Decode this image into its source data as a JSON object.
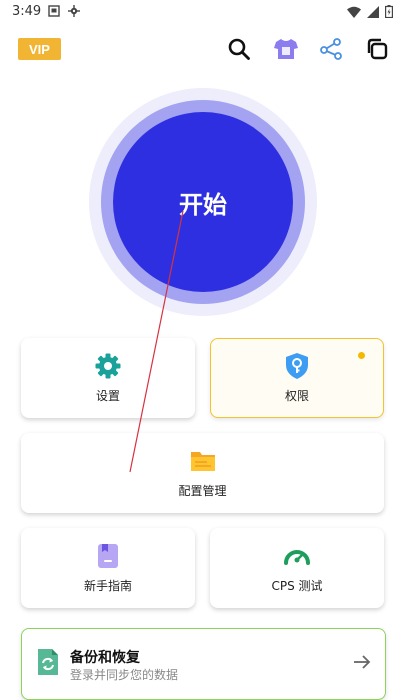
{
  "status_bar": {
    "time": "3:49",
    "left_icons": [
      "sim-card-icon",
      "settings-gear-icon"
    ],
    "right_icons": [
      "wifi-icon",
      "signal-icon",
      "battery-icon"
    ]
  },
  "header": {
    "vip_label": "VIP",
    "icons": [
      "search-icon",
      "theme-shirt-icon",
      "share-icon",
      "copy-icon"
    ]
  },
  "start_button": {
    "label": "开始"
  },
  "grid": {
    "settings_label": "设置",
    "permissions_label": "权限",
    "config_label": "配置管理",
    "guide_label": "新手指南",
    "cps_label": "CPS 测试"
  },
  "backup": {
    "title": "备份和恢复",
    "subtitle": "登录并同步您的数据"
  },
  "colors": {
    "start_blue": "#2e2fe0",
    "vip_gold": "#f2b533",
    "teal": "#1aa29a",
    "permissions_border": "#f2c230",
    "backup_border": "#8bd35c"
  }
}
